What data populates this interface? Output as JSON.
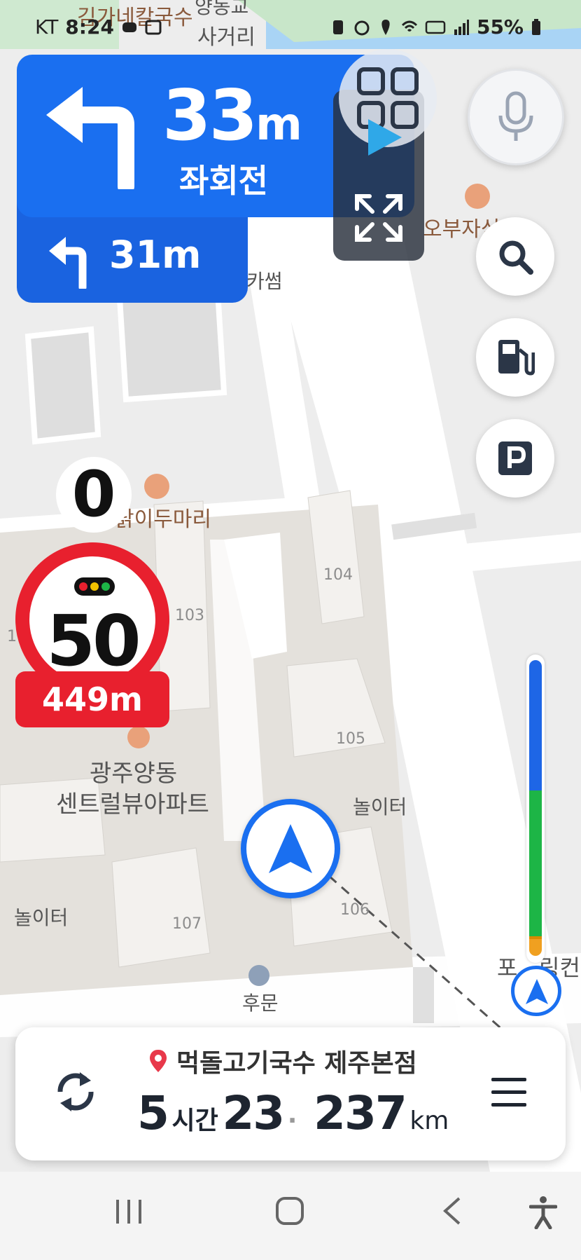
{
  "status": {
    "carrier": "KT",
    "time": "8:24",
    "battery": "55%"
  },
  "map_labels": {
    "top_poi": "김가네칼국수",
    "top_intersection_line1": "양동교",
    "top_intersection_line2": "사거리",
    "obuja": "오부자식당",
    "cafe": "카썸",
    "dakidu": "닭이두마리",
    "apt_name_line1": "광주양동",
    "apt_name_line2": "센트럴뷰아파트",
    "playground_right": "놀이터",
    "playground_left": "놀이터",
    "back_gate": "후문",
    "po_right": "포",
    "ring_right": "링컨",
    "bldg_103": "103",
    "bldg_104": "104",
    "bldg_105": "105",
    "bldg_106": "106",
    "bldg_107": "107",
    "bldg_1": "1"
  },
  "turn": {
    "distance": "33",
    "unit": "m",
    "instruction": "좌회전"
  },
  "next_turn": {
    "distance": "31m"
  },
  "speed": {
    "current": "0",
    "limit": "50",
    "camera_distance": "449m"
  },
  "route_progress": {
    "blue_fraction": 0.43,
    "green_fraction": 0.48,
    "orange_fraction": 0.06
  },
  "destination": {
    "name": "먹돌고기국수 제주본점",
    "hours": "5",
    "hours_unit": "시간",
    "minutes": "23",
    "distance": "237",
    "distance_unit": "km"
  },
  "icons": [
    "mic-icon",
    "search-icon",
    "gas-station-icon",
    "parking-icon",
    "grid-icon",
    "play-icon",
    "expand-icon",
    "reroute-icon",
    "menu-icon",
    "pin-icon"
  ],
  "colors": {
    "turn_blue": "#1a6ff0",
    "limit_red": "#e8202e",
    "traffic_green": "#1db546"
  }
}
